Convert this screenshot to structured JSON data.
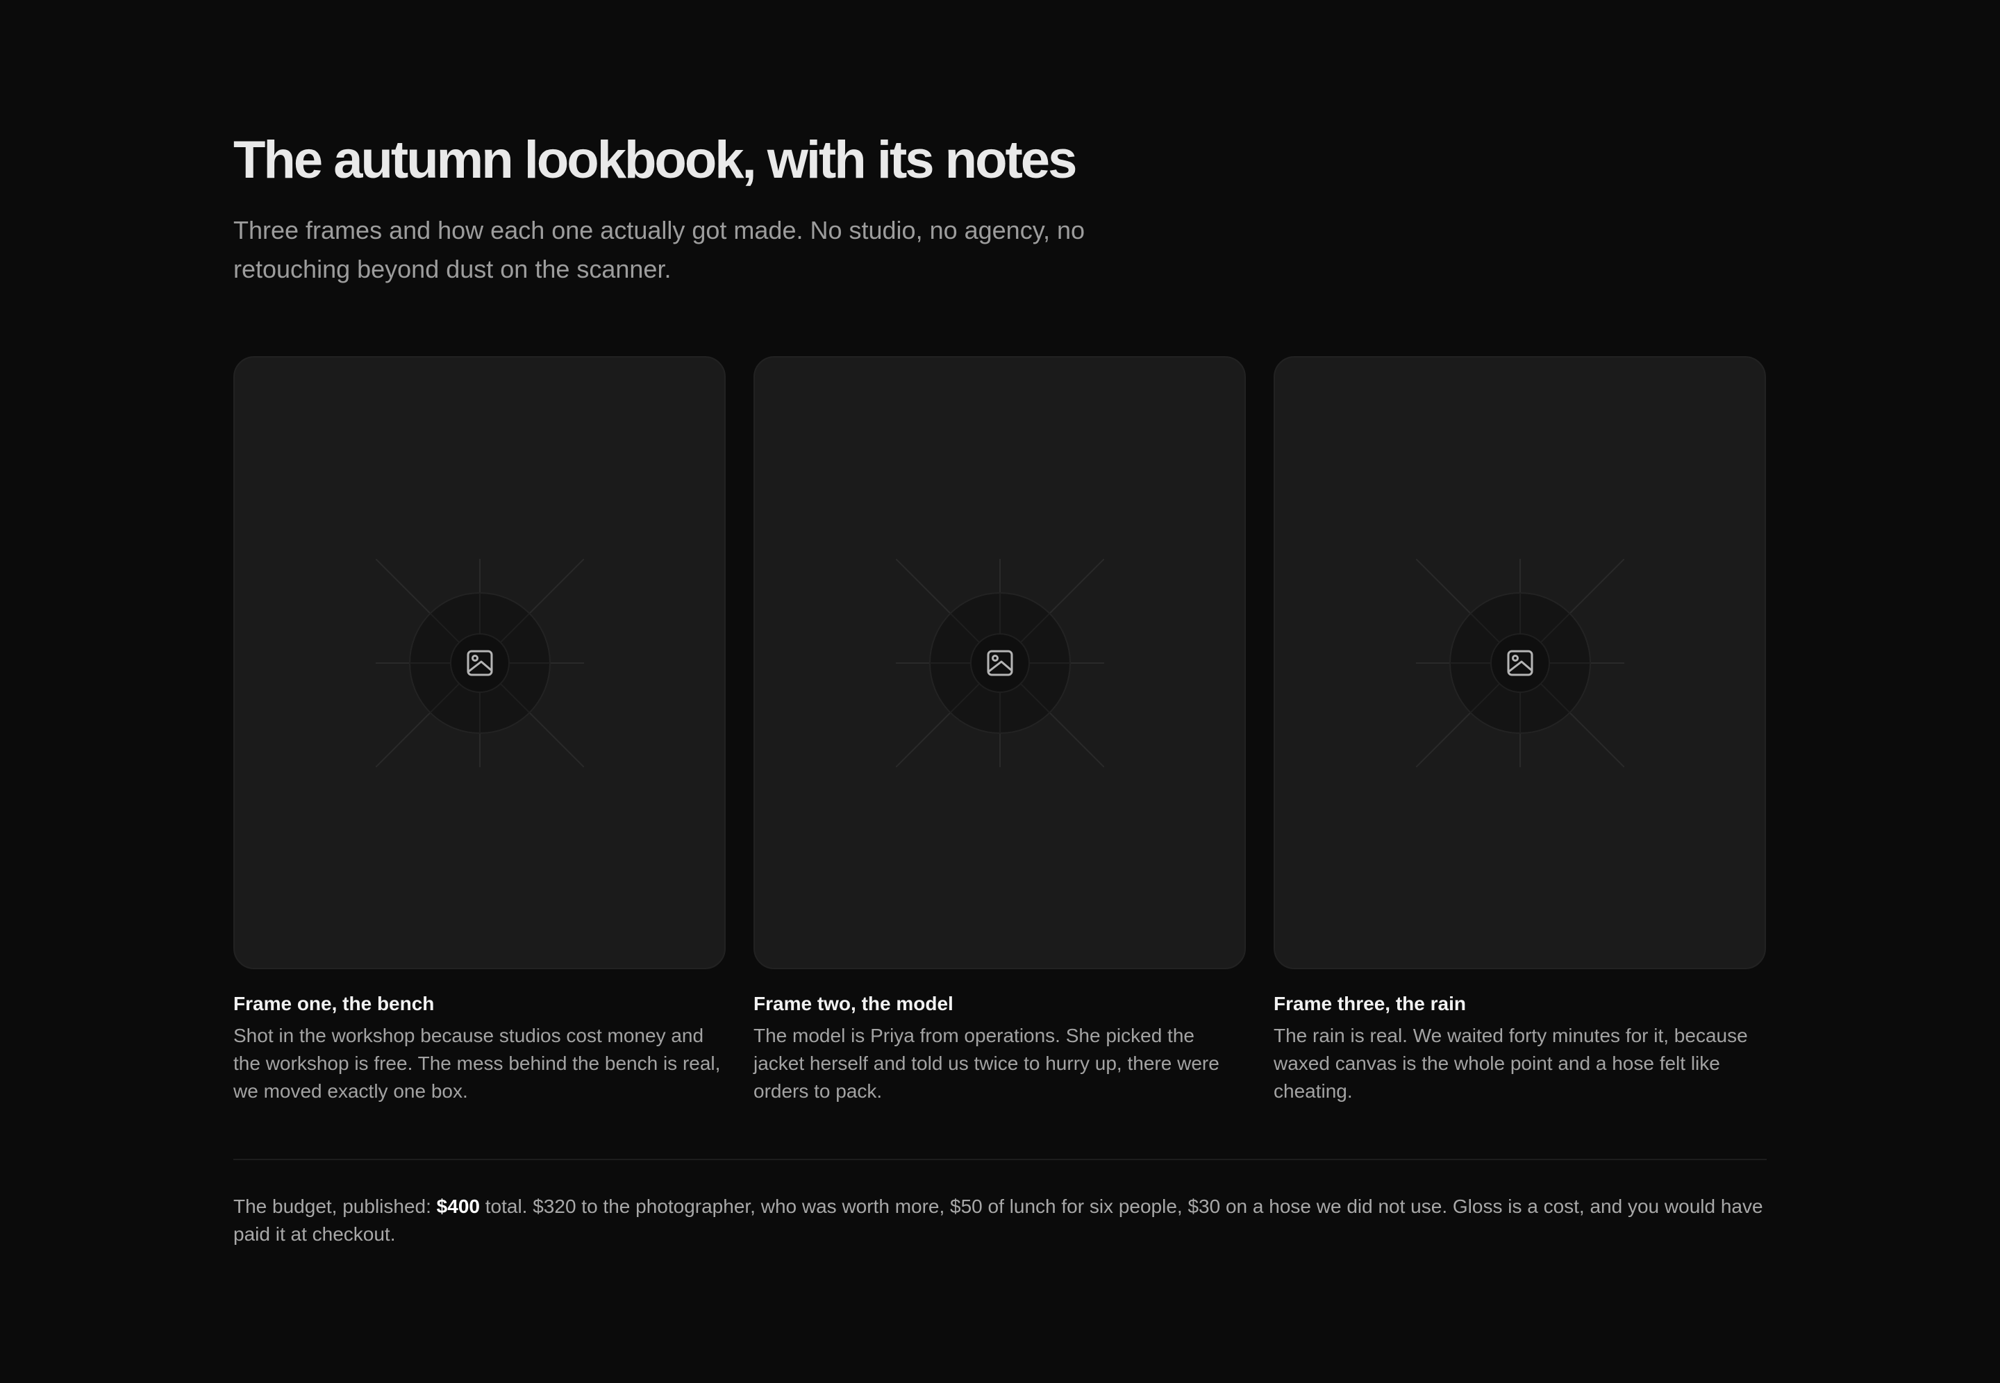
{
  "header": {
    "title": "The autumn lookbook, with its notes",
    "subtitle": "Three frames and how each one actually got made. No studio, no agency, no retouching beyond dust on the scanner."
  },
  "frames": [
    {
      "image_icon": "image-icon",
      "title": "Frame one, the bench",
      "body": "Shot in the workshop because studios cost money and the workshop is free. The mess behind the bench is real, we moved exactly one box."
    },
    {
      "image_icon": "image-icon",
      "title": "Frame two, the model",
      "body": "The model is Priya from operations. She picked the jacket herself and told us twice to hurry up, there were orders to pack."
    },
    {
      "image_icon": "image-icon",
      "title": "Frame three, the rain",
      "body": "The rain is real. We waited forty minutes for it, because waxed canvas is the whole point and a hose felt like cheating."
    }
  ],
  "budget": {
    "lead": "The budget, published: ",
    "amount": "$400",
    "rest": " total. $320 to the photographer, who was worth more, $50 of lunch for six people, $30 on a hose we did not use. Gloss is a cost, and you would have paid it at checkout."
  },
  "colors": {
    "background": "#0b0b0b",
    "card": "#1b1b1b",
    "title": "#e9e9e9",
    "muted": "#9d9d9d",
    "accent_text": "#ffffff"
  }
}
